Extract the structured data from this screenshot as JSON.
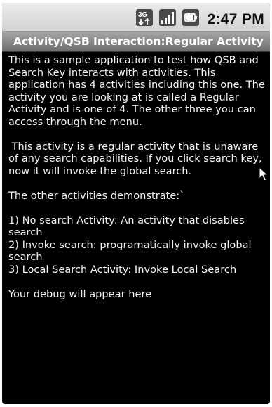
{
  "status_bar": {
    "time": "2:47 PM",
    "icons": [
      "3g-data-icon",
      "signal-strength-icon",
      "battery-icon"
    ]
  },
  "title_bar": {
    "title": "Activity/QSB Interaction:Regular Activity"
  },
  "content": {
    "intro": "This is a sample application to test how QSB and Search Key interacts with activities. This application has 4 activities including this one. The activity you are looking at is called a Regular Activity and is one of 4. The other three you can access through the menu.",
    "regular": " This activity is a regular activity that is unaware of any search capabilities. If you click search key, now it will invoke the global search.",
    "demonstrate": "The other activities demonstrate:`",
    "items": [
      "1) No search Activity: An activity that disables search",
      "2) Invoke search: programatically invoke global search",
      "3) Local Search Activity: Invoke Local Search"
    ],
    "debug": "Your debug will appear here"
  },
  "colors": {
    "background": "#000000",
    "text": "#f2f2f2",
    "title_text": "#ffffff",
    "status_bar": "#dcdcdc"
  }
}
